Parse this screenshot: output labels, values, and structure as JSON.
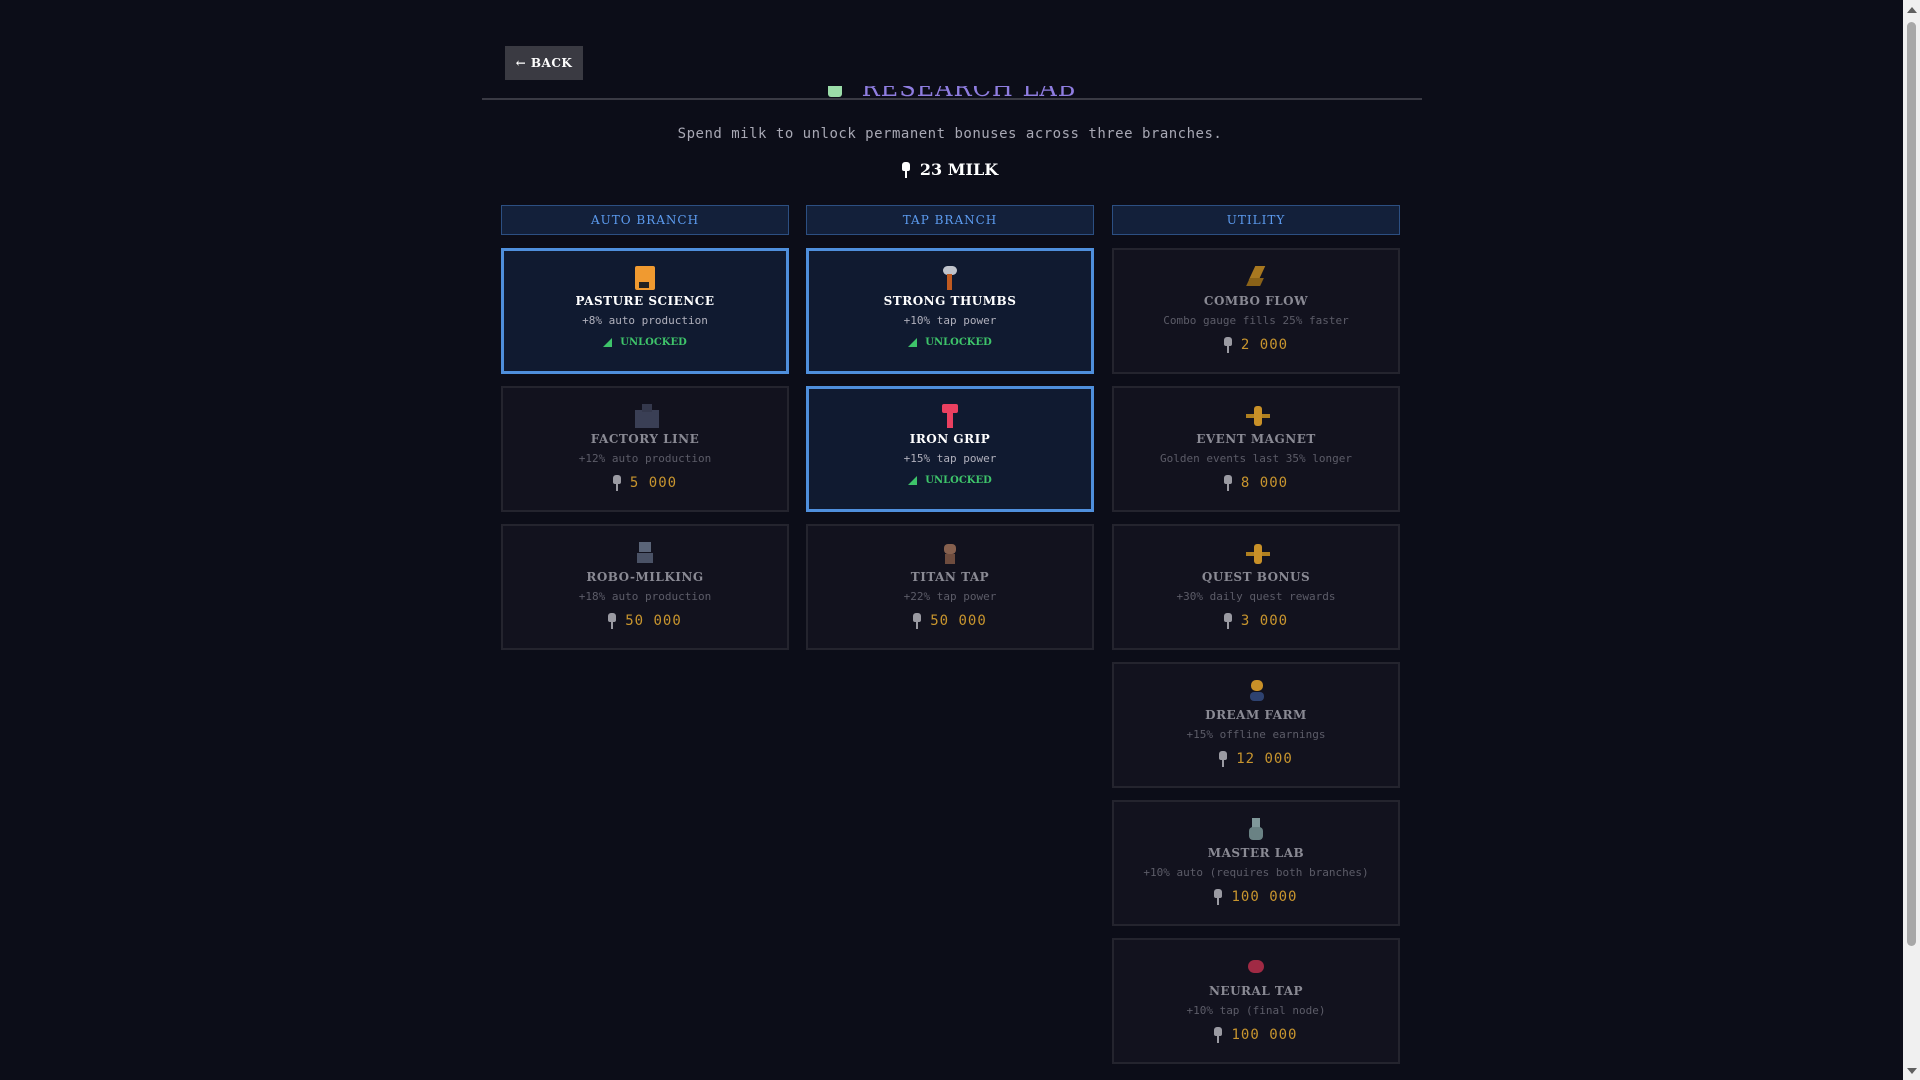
{
  "back_label": "← BACK",
  "header": {
    "title": "RESEARCH LAB",
    "subtitle": "Spend milk to unlock permanent bonuses across three branches.",
    "milk": "23 MILK"
  },
  "colors": {
    "background": "#0c0d18",
    "title": "#8f7de0",
    "branch_header_text": "#5c9bef",
    "unlocked_border": "#4f8fdc",
    "unlocked_text": "#3ec46a",
    "cost_text": "#c8952e"
  },
  "branches": [
    {
      "header": "AUTO BRANCH",
      "nodes": [
        {
          "icon": "pasture-icon",
          "name": "PASTURE SCIENCE",
          "desc": "+8% auto production",
          "status": "UNLOCKED"
        },
        {
          "icon": "factory-icon",
          "name": "FACTORY LINE",
          "desc": "+12% auto production",
          "cost": "5 000"
        },
        {
          "icon": "robot-icon",
          "name": "ROBO-MILKING",
          "desc": "+18% auto production",
          "cost": "50 000"
        }
      ]
    },
    {
      "header": "TAP BRANCH",
      "nodes": [
        {
          "icon": "hammer-icon",
          "name": "STRONG THUMBS",
          "desc": "+10% tap power",
          "status": "UNLOCKED"
        },
        {
          "icon": "iron-grip-icon",
          "name": "IRON GRIP",
          "desc": "+15% tap power",
          "status": "UNLOCKED"
        },
        {
          "icon": "titan-icon",
          "name": "TITAN TAP",
          "desc": "+22% tap power",
          "cost": "50 000"
        }
      ]
    },
    {
      "header": "UTILITY",
      "nodes": [
        {
          "icon": "lightning-icon",
          "name": "COMBO FLOW",
          "desc": "Combo gauge fills 25% faster",
          "cost": "2 000"
        },
        {
          "icon": "sparkle-icon",
          "name": "EVENT MAGNET",
          "desc": "Golden events last 35% longer",
          "cost": "8 000"
        },
        {
          "icon": "sparkle-icon",
          "name": "QUEST BONUS",
          "desc": "+30% daily quest rewards",
          "cost": "3 000"
        },
        {
          "icon": "dream-icon",
          "name": "DREAM FARM",
          "desc": "+15% offline earnings",
          "cost": "12 000"
        },
        {
          "icon": "flask-icon",
          "name": "MASTER LAB",
          "desc": "+10% auto (requires both branches)",
          "cost": "100 000"
        },
        {
          "icon": "brain-icon",
          "name": "NEURAL TAP",
          "desc": "+10% tap (final node)",
          "cost": "100 000"
        }
      ]
    }
  ]
}
